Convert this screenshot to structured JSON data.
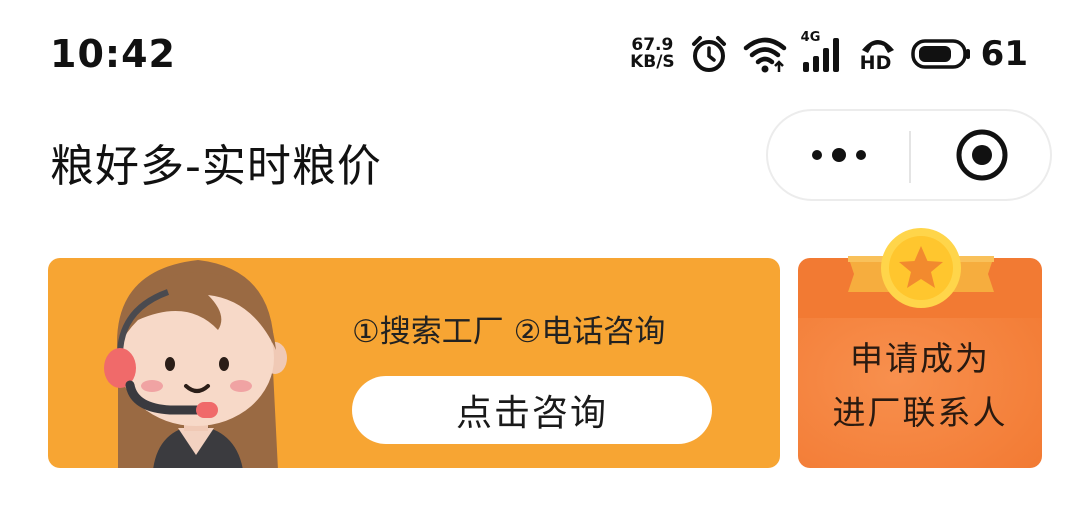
{
  "status_bar": {
    "time": "10:42",
    "net_speed_value": "67.9",
    "net_speed_unit": "KB/S",
    "network_type": "4G",
    "hd_label": "HD",
    "battery_percent": "61"
  },
  "header": {
    "title": "粮好多-实时粮价",
    "menu_icon": "more-dots-icon",
    "close_icon": "target-circle-icon"
  },
  "consult_banner": {
    "steps_text": "①搜索工厂 ②电话咨询",
    "button_label": "点击咨询",
    "illustration": "customer-service-agent"
  },
  "contact_card": {
    "line1": "申请成为",
    "line2": "进厂联系人",
    "badge_icon": "star-medal-icon"
  },
  "colors": {
    "consult_bg": "#f7a533",
    "contact_bg": "#f27a33",
    "text_dark": "#111111"
  }
}
